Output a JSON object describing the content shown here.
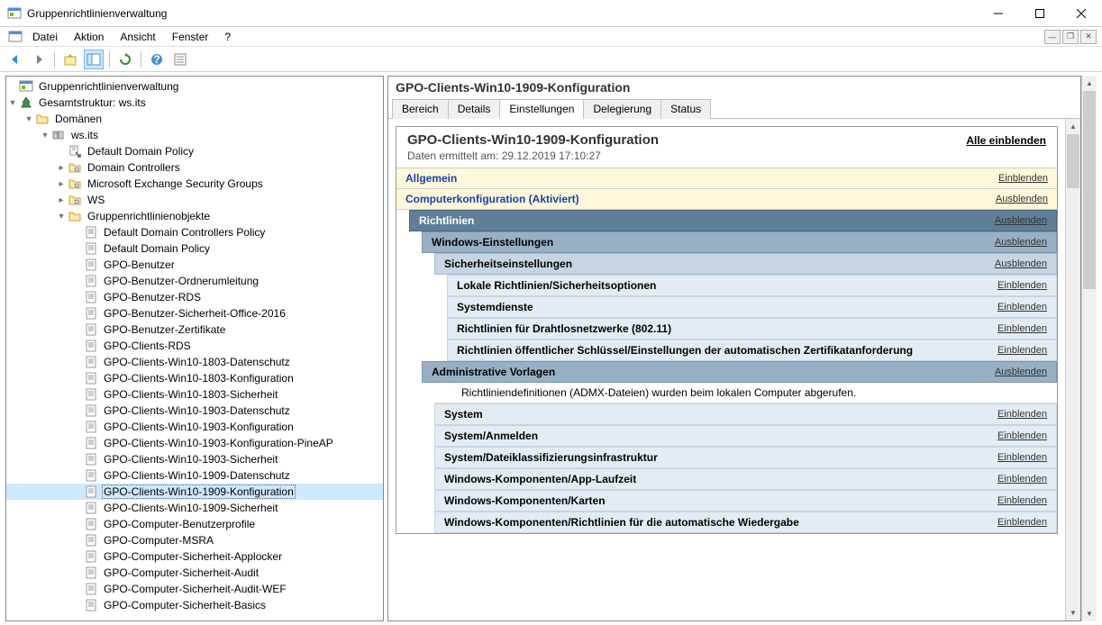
{
  "window": {
    "title": "Gruppenrichtlinienverwaltung"
  },
  "menu": {
    "datei": "Datei",
    "aktion": "Aktion",
    "ansicht": "Ansicht",
    "fenster": "Fenster",
    "help": "?"
  },
  "tree": {
    "root": "Gruppenrichtlinienverwaltung",
    "forest": "Gesamtstruktur: ws.its",
    "domains": "Domänen",
    "domain": "ws.its",
    "ddp": "Default Domain Policy",
    "dc": "Domain Controllers",
    "mesg": "Microsoft Exchange Security Groups",
    "ws": "WS",
    "gpo_container": "Gruppenrichtlinienobjekte",
    "gpos": [
      "Default Domain Controllers Policy",
      "Default Domain Policy",
      "GPO-Benutzer",
      "GPO-Benutzer-Ordnerumleitung",
      "GPO-Benutzer-RDS",
      "GPO-Benutzer-Sicherheit-Office-2016",
      "GPO-Benutzer-Zertifikate",
      "GPO-Clients-RDS",
      "GPO-Clients-Win10-1803-Datenschutz",
      "GPO-Clients-Win10-1803-Konfiguration",
      "GPO-Clients-Win10-1803-Sicherheit",
      "GPO-Clients-Win10-1903-Datenschutz",
      "GPO-Clients-Win10-1903-Konfiguration",
      "GPO-Clients-Win10-1903-Konfiguration-PineAP",
      "GPO-Clients-Win10-1903-Sicherheit",
      "GPO-Clients-Win10-1909-Datenschutz",
      "GPO-Clients-Win10-1909-Konfiguration",
      "GPO-Clients-Win10-1909-Sicherheit",
      "GPO-Computer-Benutzerprofile",
      "GPO-Computer-MSRA",
      "GPO-Computer-Sicherheit-Applocker",
      "GPO-Computer-Sicherheit-Audit",
      "GPO-Computer-Sicherheit-Audit-WEF",
      "GPO-Computer-Sicherheit-Basics"
    ],
    "selected_index": 16
  },
  "details": {
    "title": "GPO-Clients-Win10-1909-Konfiguration",
    "tabs": {
      "bereich": "Bereich",
      "details": "Details",
      "einstellungen": "Einstellungen",
      "delegierung": "Delegierung",
      "status": "Status"
    },
    "report": {
      "name": "GPO-Clients-Win10-1909-Konfiguration",
      "date_label": "Daten ermittelt am: 29.12.2019 17:10:27",
      "show_all": "Alle einblenden",
      "einblenden": "Einblenden",
      "ausblenden": "Ausblenden",
      "allgemein": "Allgemein",
      "computerconf": "Computerkonfiguration (Aktiviert)",
      "richtlinien": "Richtlinien",
      "win_einst": "Windows-Einstellungen",
      "sich_einst": "Sicherheitseinstellungen",
      "lokale": "Lokale Richtlinien/Sicherheitsoptionen",
      "systemdienste": "Systemdienste",
      "drahtlos": "Richtlinien für Drahtlosnetzwerke (802.11)",
      "schluessel": "Richtlinien öffentlicher Schlüssel/Einstellungen der automatischen Zertifikatanforderung",
      "admin_vorlagen": "Administrative Vorlagen",
      "admx_note": "Richtliniendefinitionen (ADMX-Dateien) wurden beim lokalen Computer abgerufen.",
      "system": "System",
      "anmelden": "System/Anmelden",
      "dateiklass": "System/Dateiklassifizierungsinfrastruktur",
      "app_laufzeit": "Windows-Komponenten/App-Laufzeit",
      "karten": "Windows-Komponenten/Karten",
      "wiedergabe": "Windows-Komponenten/Richtlinien für die automatische Wiedergabe"
    }
  }
}
